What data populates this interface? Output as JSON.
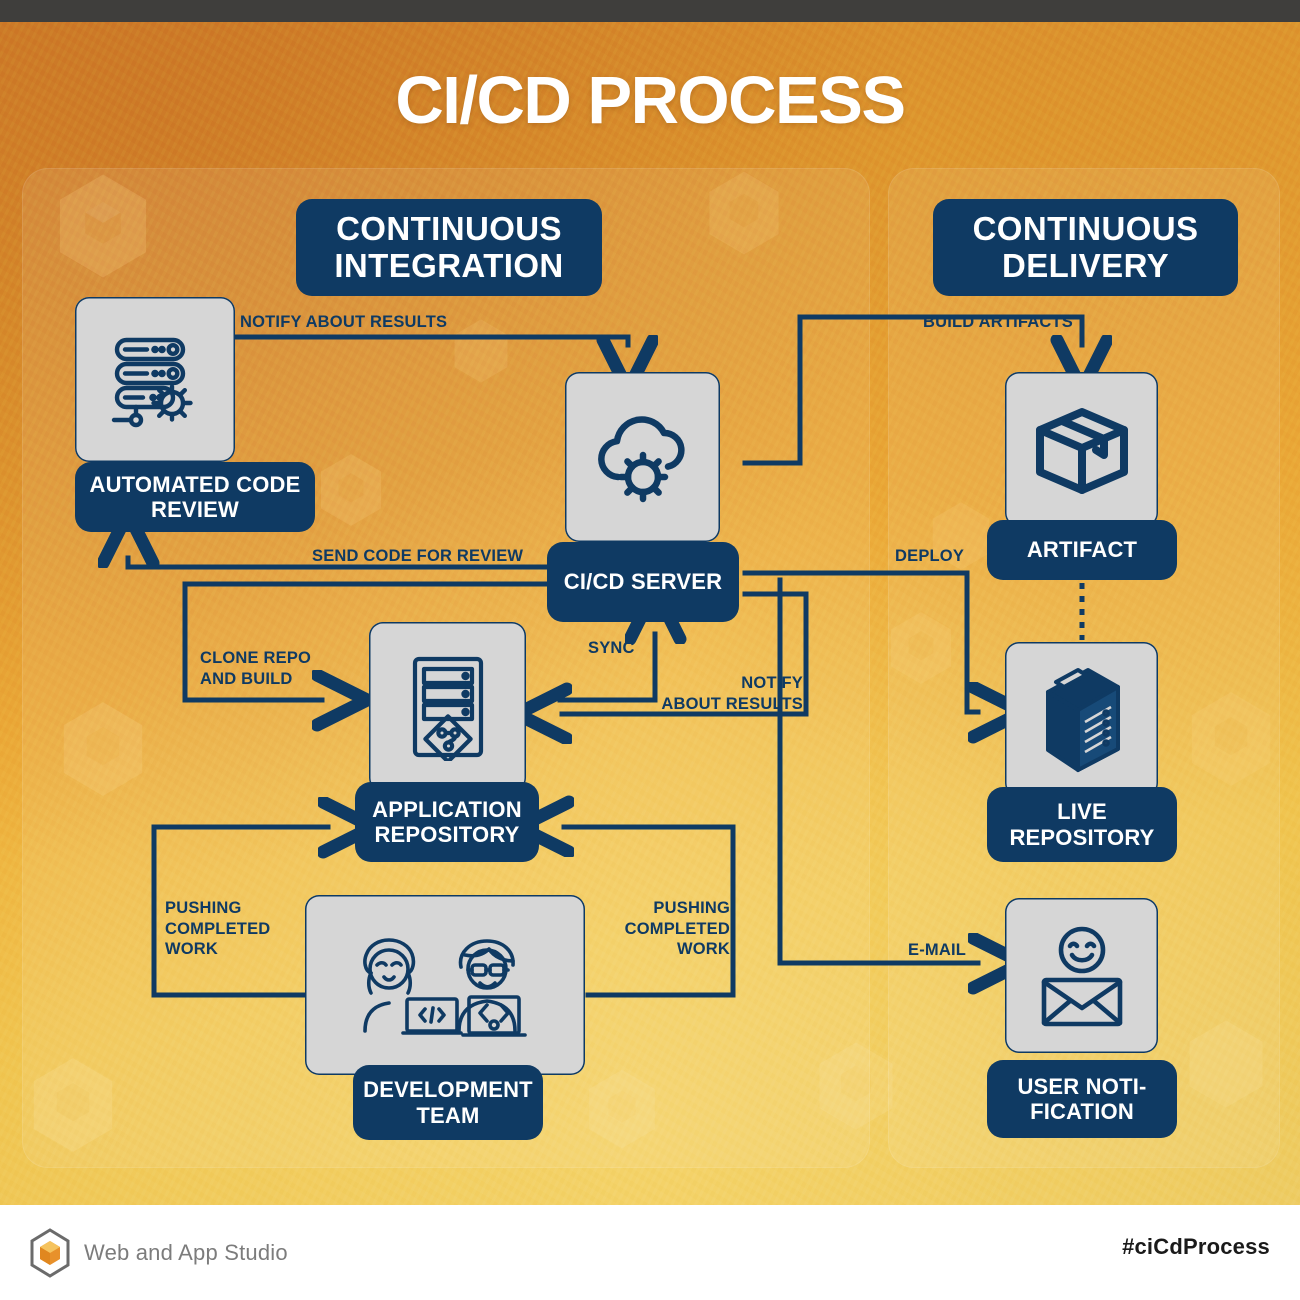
{
  "title": "CI/CD PROCESS",
  "panels": {
    "ci": {
      "header": "CONTINUOUS\nINTEGRATION"
    },
    "cd": {
      "header": "CONTINUOUS\nDELIVERY"
    }
  },
  "nodes": {
    "code_review": {
      "label": "AUTOMATED\nCODE REVIEW",
      "icon": "server-stack-gear-icon"
    },
    "cicd_server": {
      "label": "CI/CD\nSERVER",
      "icon": "cloud-gear-icon"
    },
    "app_repo": {
      "label": "APPLICATION\nREPOSITORY",
      "icon": "repository-git-icon"
    },
    "dev_team": {
      "label": "DEVELOPMENT\nTEAM",
      "icon": "developers-laptops-icon"
    },
    "artifact": {
      "label": "ARTIFACT",
      "icon": "package-box-icon"
    },
    "live_repo": {
      "label": "LIVE\nREPOSITORY",
      "icon": "server-tower-icon"
    },
    "user_notif": {
      "label": "USER NOTI-\nFICATION",
      "icon": "smiley-envelope-icon"
    }
  },
  "edges": {
    "notify_results_top": "NOTIFY ABOUT RESULTS",
    "build_artifacts": "BUILD ARTIFACTS",
    "send_code_for_review": "SEND CODE FOR REVIEW",
    "clone_repo_and_build": "CLONE REPO\nAND BUILD",
    "sync": "SYNC",
    "notify_results_mid": "NOTIFY\nABOUT RESULTS",
    "deploy": "DEPLOY",
    "pushing_left": "PUSHING\nCOMPLETED\nWORK",
    "pushing_right": "PUSHING\nCOMPLETED\nWORK",
    "email": "E-MAIL"
  },
  "footer": {
    "brand": "Web and App Studio",
    "hashtag": "#ciCdProcess",
    "logo_icon": "hexagon-cube-logo-icon"
  },
  "colors": {
    "navy": "#0f3a63",
    "card_gray": "#d6d6d6",
    "orange_top": "#d2832a",
    "gold_bottom": "#edcb63",
    "topbar": "#3f3e3c",
    "title_text": "#ffffff"
  }
}
